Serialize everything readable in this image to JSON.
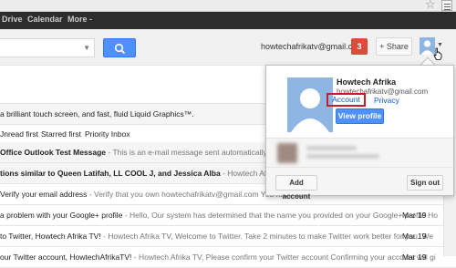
{
  "browser": {
    "star_icon": "star-outline-icon",
    "menu_icon": "hamburger-menu-icon"
  },
  "gbar": {
    "items": [
      "Drive",
      "Calendar",
      "More -"
    ]
  },
  "header": {
    "search_placeholder": "",
    "email": "howtechafrikatv@gmail.com",
    "notifications": "3",
    "share_label": "+ Share"
  },
  "inbox": {
    "promo_text": "a brilliant touch screen, and fast, fluid Liquid Graphics™.",
    "tabs": [
      "Jnread first",
      "Starred first",
      "Priority Inbox"
    ],
    "rows": [
      {
        "subject": "Office Outlook Test Message",
        "snippet": " - This is an e-mail message sent automatically by Microsoft",
        "date": "",
        "read": true
      },
      {
        "subject": "tions similar to Queen Latifah, LL COOL J, and Jessica Alba",
        "snippet": " - Howtech Afrika TV, People",
        "date": "",
        "read": true
      },
      {
        "subject": "Verify your email address",
        "snippet": " - Verify that you own howtechafrikatv@gmail.com You have se",
        "date": "",
        "read": false
      },
      {
        "subject": "a problem with your Google+ profile",
        "snippet": " - Hello, Our system has determined that the name you provided on your Google+ profile Ho",
        "date": "Mar 19",
        "read": false
      },
      {
        "subject": "to Twitter, Howtech Afrika TV!",
        "snippet": " - Howtech Afrika TV, Welcome to Twitter. Take 2 minutes to make Twitter work better for you. We",
        "date": "Mar 19",
        "read": false
      },
      {
        "subject": "our Twitter account, HowtechAfrikaTV!",
        "snippet": " - Howtech Afrika TV, Please confirm your Twitter account Confirming your account will gi",
        "date": "Mar 19",
        "read": false
      }
    ]
  },
  "account_popup": {
    "name": "Howtech Afrika",
    "email": "howtechafrikatv@gmail.com",
    "account_link": "Account",
    "privacy_link": "Privacy",
    "view_profile": "View profile",
    "add_account": "Add account",
    "sign_out": "Sign out"
  },
  "colors": {
    "blue_button": "#4d90fe",
    "highlight_box": "#c22026",
    "notification": "#dd4b39",
    "gbar": "#2d2d2d"
  }
}
